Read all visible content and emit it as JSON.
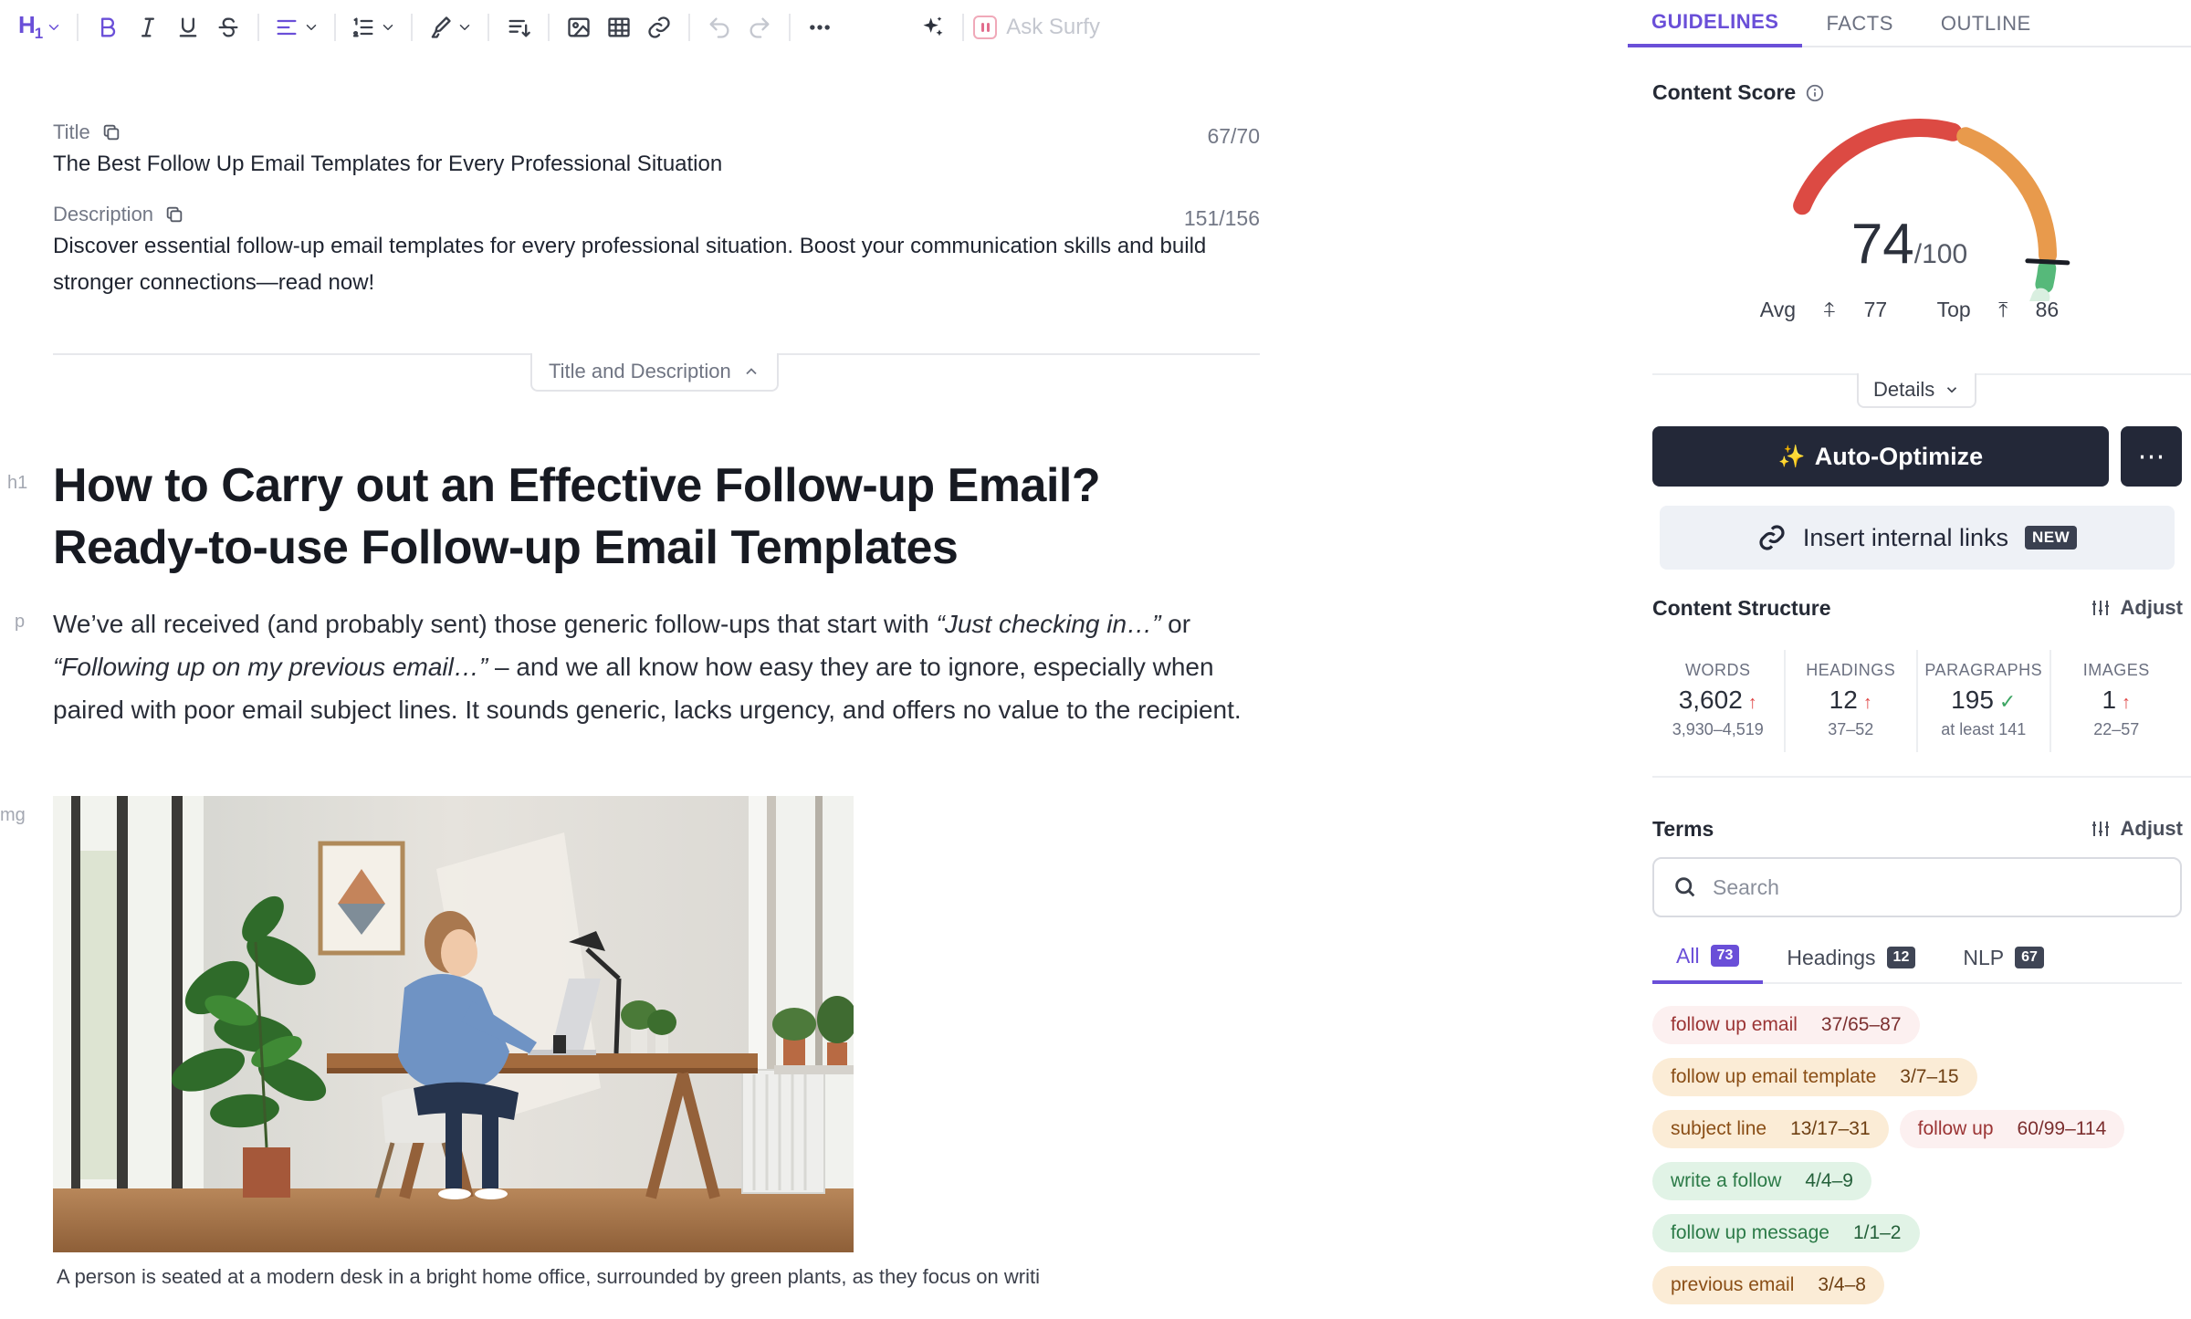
{
  "toolbar": {
    "heading_level": "H1",
    "ask_label": "Ask Surfy",
    "icons": [
      "heading-icon",
      "bold-icon",
      "italic-icon",
      "underline-icon",
      "strikethrough-icon",
      "align-icon",
      "list-icon",
      "highlighter-icon",
      "sort-icon",
      "image-icon",
      "table-icon",
      "link-icon",
      "undo-icon",
      "redo-icon",
      "more-icon",
      "sparkle-icon"
    ]
  },
  "meta": {
    "title_label": "Title",
    "title_count": "67/70",
    "title_value": "The Best Follow Up Email Templates for Every Professional Situation",
    "description_label": "Description",
    "description_count": "151/156",
    "description_value": "Discover essential follow-up email templates for every professional situation. Boost your communication skills and build stronger connections—read now!",
    "collapse_label": "Title and Description"
  },
  "article": {
    "gutter_h1": "h1",
    "gutter_p": "p",
    "gutter_img": "mg",
    "heading": "How to Carry out an Effective Follow-up Email? Ready-to-use Follow-up Email Templates",
    "para_part1": "We’ve all received (and probably sent) those generic follow-ups that start with ",
    "para_em1": "“Just checking in…”",
    "para_part2": " or ",
    "para_em2": "“Following up on my previous email…”",
    "para_part3": " – and we all know how easy they are to ignore, especially when paired with poor email subject lines. It sounds generic, lacks urgency, and offers no value to the recipient.",
    "caption": "A person is seated at a modern desk in a bright home office, surrounded by green plants, as they focus on writi"
  },
  "panel": {
    "tabs": [
      {
        "label": "GUIDELINES",
        "active": true
      },
      {
        "label": "FACTS",
        "active": false
      },
      {
        "label": "OUTLINE",
        "active": false
      }
    ],
    "content_score_title": "Content Score",
    "score": 74,
    "score_text": "74",
    "score_max": "/100",
    "avg_label": "Avg",
    "avg_value": "77",
    "top_label": "Top",
    "top_value": "86",
    "details_label": "Details",
    "auto_optimize_label": "Auto-Optimize",
    "insert_links_label": "Insert internal links",
    "new_badge": "NEW",
    "structure_title": "Content Structure",
    "adjust_label": "Adjust",
    "stats": [
      {
        "label": "WORDS",
        "value": "3,602",
        "range": "3,930–4,519",
        "status": "up"
      },
      {
        "label": "HEADINGS",
        "value": "12",
        "range": "37–52",
        "status": "up"
      },
      {
        "label": "PARAGRAPHS",
        "value": "195",
        "range": "at least 141",
        "status": "ok"
      },
      {
        "label": "IMAGES",
        "value": "1",
        "range": "22–57",
        "status": "up"
      }
    ],
    "terms_title": "Terms",
    "search_placeholder": "Search",
    "term_tabs": [
      {
        "label": "All",
        "count": "73",
        "active": true
      },
      {
        "label": "Headings",
        "count": "12",
        "active": false
      },
      {
        "label": "NLP",
        "count": "67",
        "active": false
      }
    ],
    "terms": [
      [
        {
          "term": "follow up email",
          "value": "37/65–87",
          "tone": "red"
        }
      ],
      [
        {
          "term": "follow up email template",
          "value": "3/7–15",
          "tone": "orange"
        }
      ],
      [
        {
          "term": "subject line",
          "value": "13/17–31",
          "tone": "orange"
        },
        {
          "term": "follow up",
          "value": "60/99–114",
          "tone": "red"
        }
      ],
      [
        {
          "term": "write a follow",
          "value": "4/4–9",
          "tone": "green"
        }
      ],
      [
        {
          "term": "follow up message",
          "value": "1/1–2",
          "tone": "green"
        }
      ],
      [
        {
          "term": "previous email",
          "value": "3/4–8",
          "tone": "orange"
        }
      ]
    ],
    "colors": {
      "accent": "#6a4fd8",
      "gauge_red": "#dc4a43",
      "gauge_orange": "#e89a4c",
      "gauge_green": "#56b97a",
      "gauge_light_green": "#d9efe0",
      "button_dark": "#232838"
    }
  }
}
